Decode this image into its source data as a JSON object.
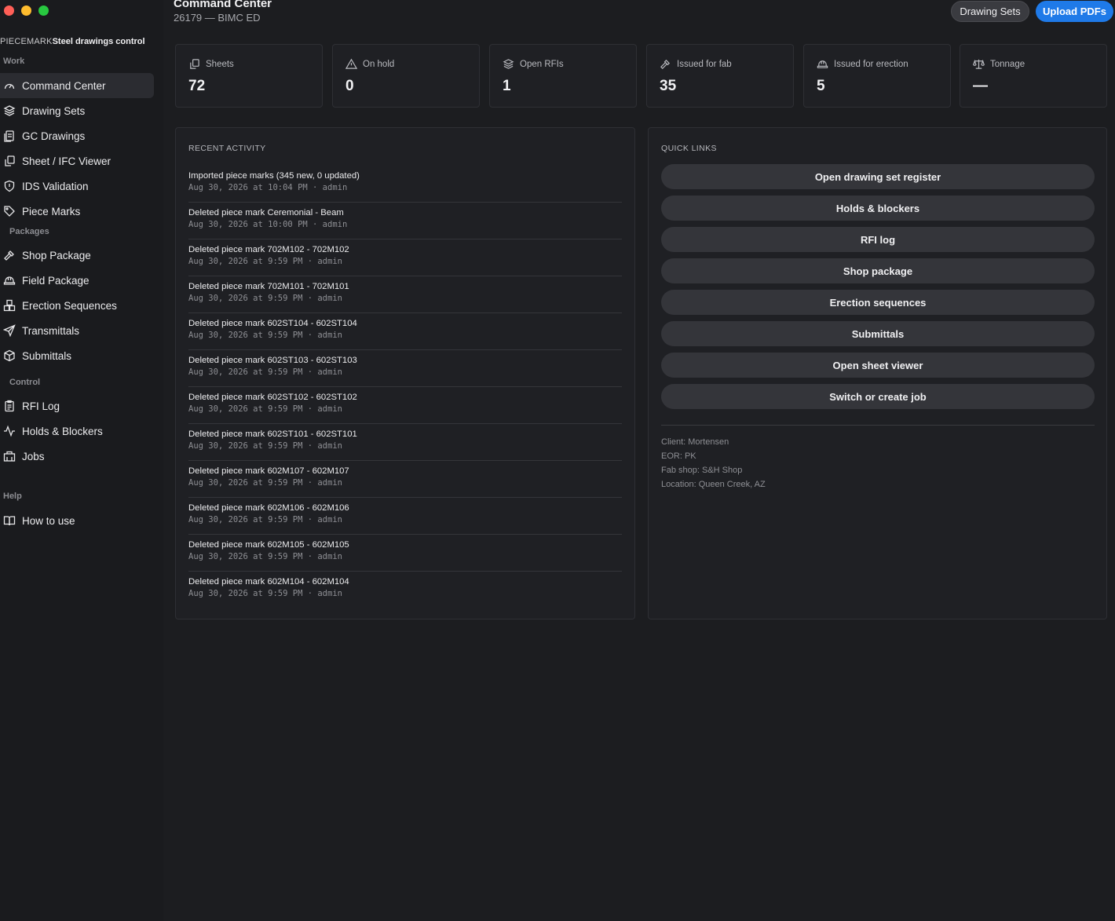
{
  "window": {
    "traffic_lights": {
      "close": "#ff5f57",
      "minimize": "#febc2e",
      "zoom": "#28c840"
    }
  },
  "sidebar": {
    "brand_prefix": "PIECEMARK",
    "brand_name": "Steel drawings control",
    "sections": {
      "work": "Work",
      "packages": "Packages",
      "control": "Control",
      "help": "Help"
    },
    "items": [
      {
        "label": "Command Center",
        "icon": "gauge-icon"
      },
      {
        "label": "Drawing Sets",
        "icon": "layers-icon"
      },
      {
        "label": "GC Drawings",
        "icon": "file-stack-icon"
      },
      {
        "label": "Sheet / IFC Viewer",
        "icon": "files-icon"
      },
      {
        "label": "IDS Validation",
        "icon": "shield-icon"
      },
      {
        "label": "Piece Marks",
        "icon": "tag-icon"
      },
      {
        "label": "Shop Package",
        "icon": "hammer-icon"
      },
      {
        "label": "Field Package",
        "icon": "hard-hat-icon"
      },
      {
        "label": "Erection Sequences",
        "icon": "boxes-icon"
      },
      {
        "label": "Transmittals",
        "icon": "send-icon"
      },
      {
        "label": "Submittals",
        "icon": "package-icon"
      },
      {
        "label": "RFI Log",
        "icon": "clipboard-list-icon"
      },
      {
        "label": "Holds & Blockers",
        "icon": "activity-icon"
      },
      {
        "label": "Jobs",
        "icon": "building-icon"
      },
      {
        "label": "How to use",
        "icon": "book-icon"
      }
    ]
  },
  "header": {
    "title": "Command Center",
    "subtitle": "26179 — BIMC ED",
    "drawing_sets_button": "Drawing Sets",
    "upload_button": "Upload PDFs",
    "accent_color": "#1f7ae8"
  },
  "stats": [
    {
      "label": "Sheets",
      "value": "72",
      "icon": "files-icon"
    },
    {
      "label": "On hold",
      "value": "0",
      "icon": "warning-triangle-icon"
    },
    {
      "label": "Open RFIs",
      "value": "1",
      "icon": "layers-icon"
    },
    {
      "label": "Issued for fab",
      "value": "35",
      "icon": "hammer-icon"
    },
    {
      "label": "Issued for erection",
      "value": "5",
      "icon": "hard-hat-icon"
    },
    {
      "label": "Tonnage",
      "value": "—",
      "icon": "scale-icon"
    }
  ],
  "recent_activity": {
    "title": "RECENT ACTIVITY",
    "items": [
      {
        "text": "Imported piece marks (345 new, 0 updated)",
        "meta": "Aug 30, 2026 at 10:04 PM · admin"
      },
      {
        "text": "Deleted piece mark Ceremonial - Beam",
        "meta": "Aug 30, 2026 at 10:00 PM · admin"
      },
      {
        "text": "Deleted piece mark 702M102 - 702M102",
        "meta": "Aug 30, 2026 at 9:59 PM · admin"
      },
      {
        "text": "Deleted piece mark 702M101 - 702M101",
        "meta": "Aug 30, 2026 at 9:59 PM · admin"
      },
      {
        "text": "Deleted piece mark 602ST104 - 602ST104",
        "meta": "Aug 30, 2026 at 9:59 PM · admin"
      },
      {
        "text": "Deleted piece mark 602ST103 - 602ST103",
        "meta": "Aug 30, 2026 at 9:59 PM · admin"
      },
      {
        "text": "Deleted piece mark 602ST102 - 602ST102",
        "meta": "Aug 30, 2026 at 9:59 PM · admin"
      },
      {
        "text": "Deleted piece mark 602ST101 - 602ST101",
        "meta": "Aug 30, 2026 at 9:59 PM · admin"
      },
      {
        "text": "Deleted piece mark 602M107 - 602M107",
        "meta": "Aug 30, 2026 at 9:59 PM · admin"
      },
      {
        "text": "Deleted piece mark 602M106 - 602M106",
        "meta": "Aug 30, 2026 at 9:59 PM · admin"
      },
      {
        "text": "Deleted piece mark 602M105 - 602M105",
        "meta": "Aug 30, 2026 at 9:59 PM · admin"
      },
      {
        "text": "Deleted piece mark 602M104 - 602M104",
        "meta": "Aug 30, 2026 at 9:59 PM · admin"
      }
    ]
  },
  "quick_links": {
    "title": "QUICK LINKS",
    "items": [
      "Open drawing set register",
      "Holds & blockers",
      "RFI log",
      "Shop package",
      "Erection sequences",
      "Submittals",
      "Open sheet viewer",
      "Switch or create job"
    ],
    "meta": {
      "client": "Client: Mortensen",
      "eor": "EOR: PK",
      "fab_shop": "Fab shop: S&H Shop",
      "location": "Location: Queen Creek, AZ"
    }
  }
}
